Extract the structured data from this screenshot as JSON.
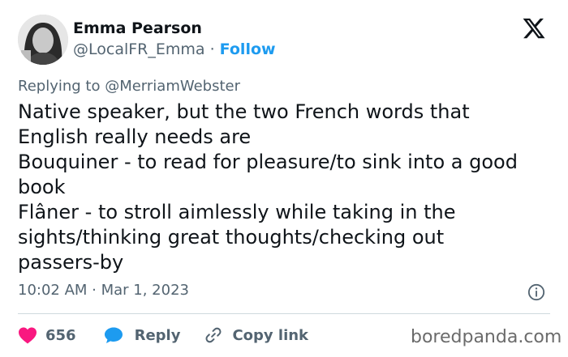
{
  "author": {
    "name": "Emma Pearson",
    "handle": "@LocalFR_Emma",
    "separator": " · ",
    "follow_label": "Follow"
  },
  "platform_icon": "x-logo-icon",
  "reply_context": {
    "prefix": "Replying to ",
    "mention": "@MerriamWebster"
  },
  "tweet": {
    "text": "Native speaker, but the two French words that\nEnglish really needs are\nBouquiner - to read for pleasure/to sink into a good\nbook\nFlâner - to stroll aimlessly while taking in the\nsights/thinking great thoughts/checking out\npassers-by",
    "timestamp": "10:02 AM · Mar 1, 2023"
  },
  "actions": {
    "likes_count": "656",
    "reply_label": "Reply",
    "copy_link_label": "Copy link"
  },
  "icons": {
    "like": "heart-icon",
    "reply": "speech-bubble-icon",
    "copy": "link-icon",
    "info": "info-icon"
  },
  "colors": {
    "like": "#f91880",
    "reply": "#1d9bf0",
    "follow": "#1d9bf0",
    "secondary_text": "#536471"
  },
  "watermark": "boredpanda.com"
}
